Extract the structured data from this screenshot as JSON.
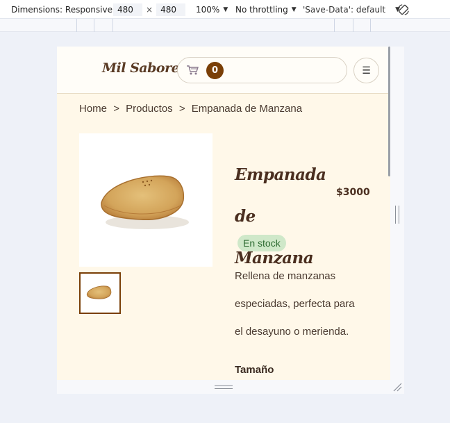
{
  "devtools": {
    "dimensions_label": "Dimensions: Responsive",
    "width_value": "480",
    "times": "×",
    "height_value": "480",
    "zoom": "100%",
    "throttling": "No throttling",
    "save_data": "'Save-Data': default"
  },
  "site": {
    "logo": "Mil Sabores",
    "cart_count": "0",
    "menu_icon": "☰"
  },
  "breadcrumb": [
    "Home",
    ">",
    "Productos",
    ">",
    "Empanada de Manzana"
  ],
  "product": {
    "title_line1": "Empanada",
    "title_line2": "de Manzana",
    "price": "$3000",
    "stock": "En stock",
    "description_lines": [
      "Rellena de manzanas",
      "especiadas, perfecta para",
      "el desayuno o merienda."
    ],
    "size_label": "Tamaño"
  },
  "colors": {
    "accent": "#7a3f07",
    "page_bg": "#fff8e9",
    "stock_bg": "#cfe8c9",
    "stock_text": "#2d6a31"
  }
}
